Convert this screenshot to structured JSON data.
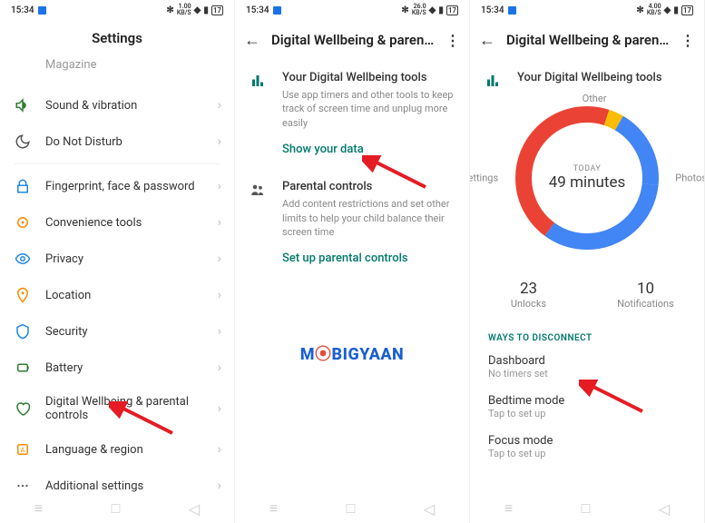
{
  "status": {
    "time": "15:34",
    "net1": "1.00",
    "net1u": "KB/S",
    "net2": "26.0",
    "net2u": "KB/S",
    "net3": "4.00",
    "net3u": "KB/S",
    "batt": "17"
  },
  "screen1": {
    "title": "Settings",
    "items": {
      "magazine": "Magazine",
      "sound": "Sound & vibration",
      "dnd": "Do Not Disturb",
      "fingerprint": "Fingerprint, face & password",
      "convenience": "Convenience tools",
      "privacy": "Privacy",
      "location": "Location",
      "security": "Security",
      "battery": "Battery",
      "wellbeing": "Digital Wellbeing & parental controls",
      "language": "Language & region",
      "additional": "Additional settings"
    }
  },
  "screen2": {
    "title": "Digital Wellbeing & paren…",
    "tools_title": "Your Digital Wellbeing tools",
    "tools_desc": "Use app timers and other tools to keep track of screen time and unplug more easily",
    "show_data": "Show your data",
    "parental_title": "Parental controls",
    "parental_desc": "Add content restrictions and set other limits to help your child balance their screen time",
    "setup_parental": "Set up parental controls",
    "logo_m": "M",
    "logo_rest": "BIGYAAN"
  },
  "screen3": {
    "title": "Digital Wellbeing & paren…",
    "tools_title": "Your Digital Wellbeing tools",
    "today_label": "TODAY",
    "today_value": "49 minutes",
    "seg_other": "Other",
    "seg_photos": "Photos",
    "seg_settings": "Settings",
    "unlocks_num": "23",
    "unlocks_label": "Unlocks",
    "notif_num": "10",
    "notif_label": "Notifications",
    "section_head": "WAYS TO DISCONNECT",
    "dashboard_t": "Dashboard",
    "dashboard_s": "No timers set",
    "bedtime_t": "Bedtime mode",
    "bedtime_s": "Tap to set up",
    "focus_t": "Focus mode",
    "focus_s": "Tap to set up"
  },
  "chart_data": {
    "type": "pie",
    "title": "TODAY 49 minutes",
    "series": [
      {
        "name": "Photos",
        "value": 20,
        "color": "#4285f4"
      },
      {
        "name": "Settings",
        "value": 13,
        "color": "#ea4335"
      },
      {
        "name": "Other (blue)",
        "value": 11,
        "color": "#4285f4"
      },
      {
        "name": "Other (yellow)",
        "value": 2,
        "color": "#fbbc04"
      },
      {
        "name": "Other (red)",
        "value": 3,
        "color": "#ea4335"
      }
    ]
  }
}
